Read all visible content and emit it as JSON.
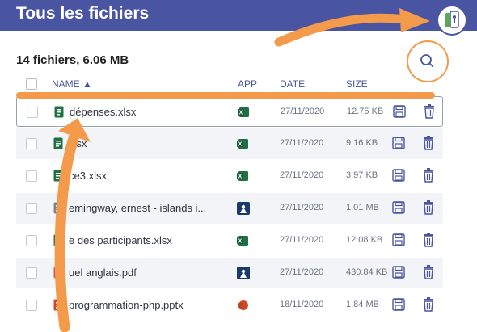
{
  "header": {
    "title": "Tous les fichiers"
  },
  "summary": "14 fichiers, 6.06 MB",
  "columns": {
    "name": "NAME ▲",
    "app": "APP",
    "date": "DATE",
    "size": "SIZE"
  },
  "rows": [
    {
      "name": "dépenses.xlsx",
      "file_type": "xlsx-icon",
      "app": "excel-icon",
      "date": "27/11/2020",
      "size": "12.75 KB"
    },
    {
      "name": "xlsx",
      "file_type": "xlsx-icon",
      "app": "excel-icon",
      "date": "27/11/2020",
      "size": "9.16 KB"
    },
    {
      "name": "ce3.xlsx",
      "file_type": "xlsx-icon",
      "app": "excel-icon",
      "date": "27/11/2020",
      "size": "3.97 KB"
    },
    {
      "name": "emingway, ernest - islands i...",
      "file_type": "ebook-icon",
      "app": "reader-icon",
      "date": "27/11/2020",
      "size": "1.01 MB"
    },
    {
      "name": "e des participants.xlsx",
      "file_type": "xlsx-icon",
      "app": "excel-icon",
      "date": "27/11/2020",
      "size": "12.08 KB"
    },
    {
      "name": "uel anglais.pdf",
      "file_type": "pdf-icon",
      "app": "reader-icon",
      "date": "27/11/2020",
      "size": "430.84 KB"
    },
    {
      "name": "programmation-php.pptx",
      "file_type": "pptx-icon",
      "app": "powerpoint-icon",
      "date": "18/11/2020",
      "size": "1.84 MB"
    }
  ],
  "colors": {
    "header": "#4a55a2",
    "accent": "#f2994a",
    "excel": "#1e7145",
    "powerpoint": "#d24726",
    "pdf": "#d9534f"
  }
}
